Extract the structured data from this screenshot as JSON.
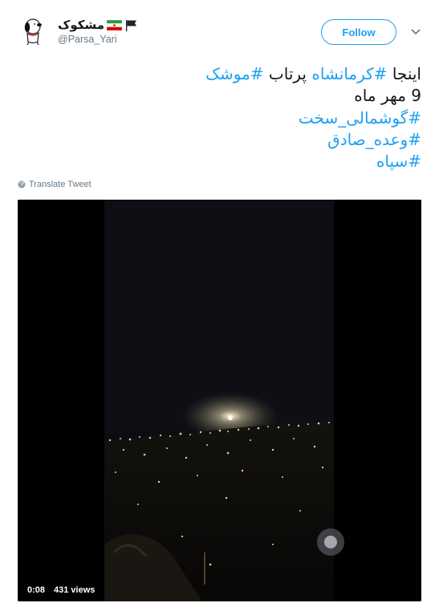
{
  "author": {
    "name": "مشکوک",
    "handle": "@Parsa_Yari",
    "avatar_icon": "snoopy-avatar-icon",
    "flags": [
      "iran-flag-icon",
      "black-flag-icon"
    ]
  },
  "follow_label": "Follow",
  "tweet": {
    "line1_plain_start": "اینجا ",
    "line1_tag1": "#کرمانشاه",
    "line1_plain_mid": " پرتاب ",
    "line1_tag2": "#موشک",
    "line2": "9 مهر ماه",
    "line3_tag": "#گوشمالی_سخت",
    "line4_tag": "#وعده_صادق",
    "line5_tag": "#سپاه"
  },
  "translate_label": "Translate Tweet",
  "video": {
    "duration": "0:08",
    "views": "431 views"
  },
  "colors": {
    "accent": "#1da1f2",
    "secondary_text": "#657786",
    "primary_text": "#14171a"
  }
}
